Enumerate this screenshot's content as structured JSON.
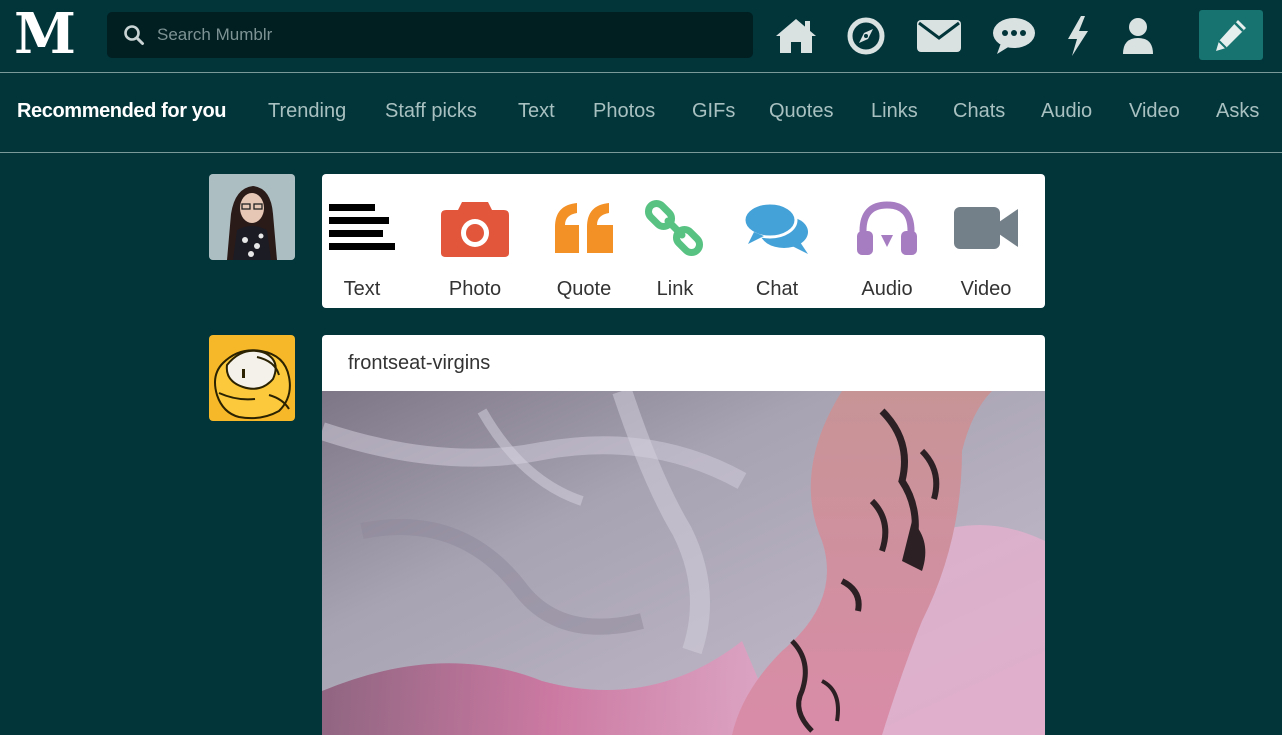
{
  "header": {
    "logo": "M",
    "search": {
      "placeholder": "Search Mumblr",
      "value": ""
    },
    "nav_icons": [
      "home-icon",
      "compass-icon",
      "mail-icon",
      "chat-bubble-icon",
      "lightning-icon",
      "user-icon"
    ],
    "compose_icon": "pencil-icon"
  },
  "tabs": [
    "Recommended for you",
    "Trending",
    "Staff picks",
    "Text",
    "Photos",
    "GIFs",
    "Quotes",
    "Links",
    "Chats",
    "Audio",
    "Video",
    "Asks"
  ],
  "post_types": [
    {
      "label": "Text",
      "icon": "text-lines-icon",
      "color": "#000000"
    },
    {
      "label": "Photo",
      "icon": "camera-icon",
      "color": "#e2573b"
    },
    {
      "label": "Quote",
      "icon": "quote-icon",
      "color": "#f39026"
    },
    {
      "label": "Link",
      "icon": "link-icon",
      "color": "#58c283"
    },
    {
      "label": "Chat",
      "icon": "chat-icon",
      "color": "#45a2d8"
    },
    {
      "label": "Audio",
      "icon": "headphones-icon",
      "color": "#a77dc2"
    },
    {
      "label": "Video",
      "icon": "video-camera-icon",
      "color": "#748089"
    }
  ],
  "post": {
    "author": "frontseat-virgins"
  },
  "colors": {
    "background": "#01353a",
    "accent": "#17736f",
    "search_bg": "#011e21"
  }
}
